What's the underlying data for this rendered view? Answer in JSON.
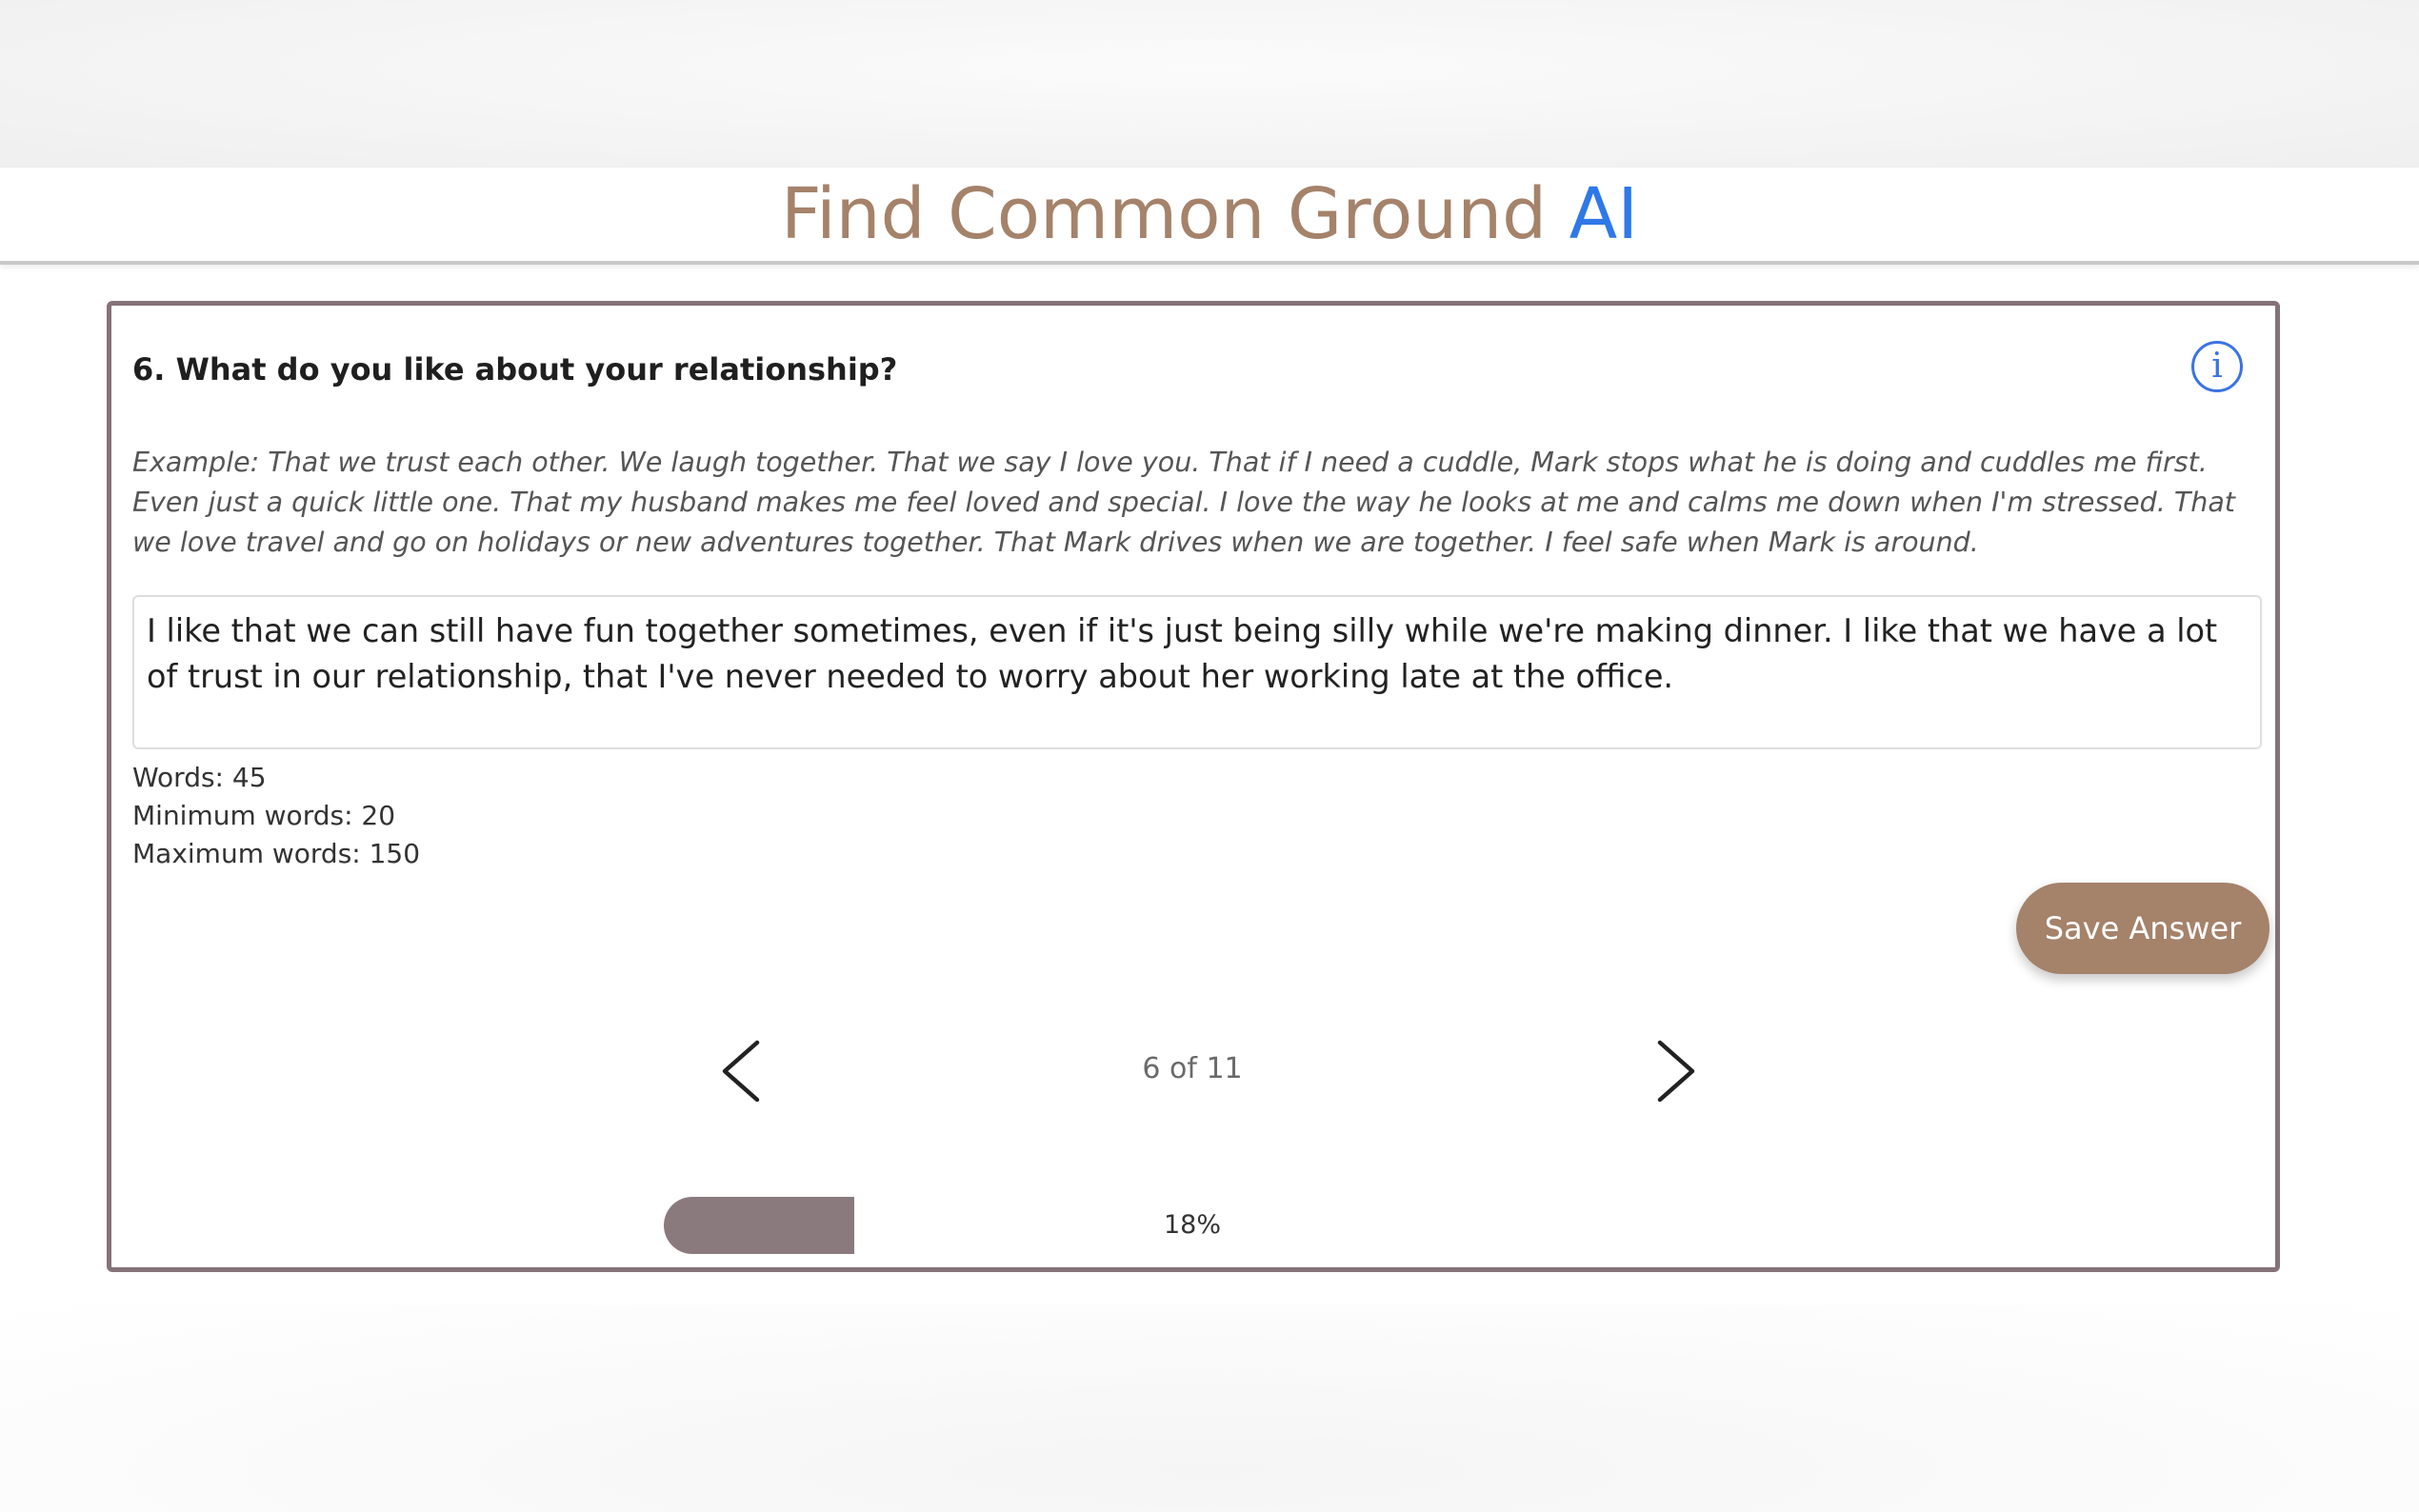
{
  "header": {
    "brand_part1": "Find Common Ground",
    "brand_part2": "AI",
    "colors": {
      "brand_brown": "#a5826a",
      "brand_blue": "#2f78e8"
    }
  },
  "question": {
    "title": "6. What do you like about your relationship?",
    "info_icon": "info-icon",
    "info_glyph": "i",
    "example": "Example: That we trust each other. We laugh together. That we say I love you. That if I need a cuddle, Mark stops what he is doing and cuddles me first. Even just a quick little one. That my husband makes me feel loved and special. I love the way he looks at me and calms me down when I'm stressed. That we love travel and go on holidays or new adventures together. That Mark drives when we are together. I feel safe when Mark is around."
  },
  "answer": {
    "value": "I like that we can still have fun together sometimes, even if it's just being silly while we're making dinner. I like that we have a lot of trust in our relationship, that I've never needed to worry about her working late at the office."
  },
  "word_count": {
    "words": "Words: 45",
    "minimum": "Minimum words: 20",
    "maximum": "Maximum words: 150"
  },
  "actions": {
    "save_label": "Save Answer"
  },
  "navigation": {
    "prev_icon": "chevron-left-icon",
    "next_icon": "chevron-right-icon",
    "page_indicator": "6 of 11"
  },
  "progress": {
    "percent": 18,
    "label": "18%",
    "fill_color": "#8a7a7e"
  },
  "card": {
    "border_color": "#867279"
  }
}
